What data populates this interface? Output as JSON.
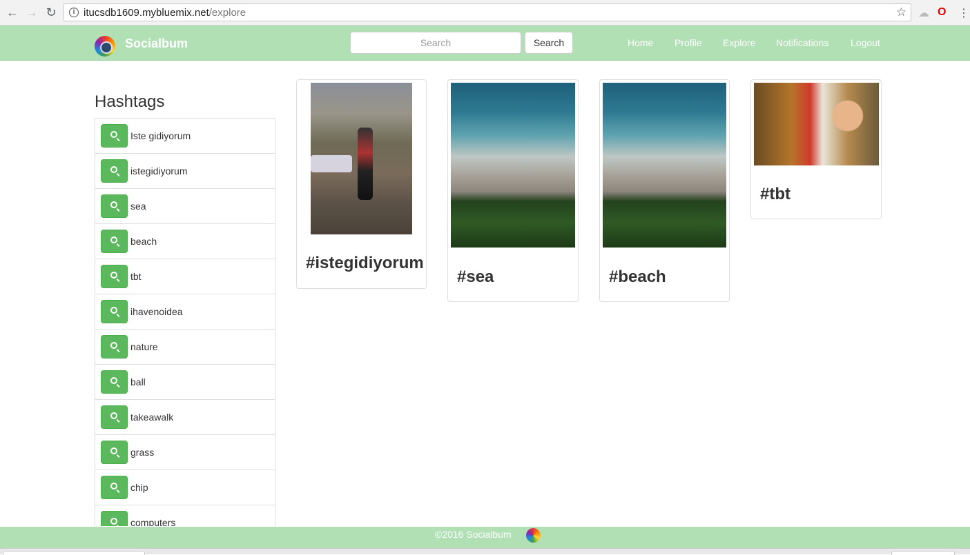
{
  "browser": {
    "url_domain": "itucsdb1609.mybluemix.net",
    "url_path": "/explore"
  },
  "navbar": {
    "brand": "Socialbum",
    "search_placeholder": "Search",
    "search_button": "Search",
    "links": [
      "Home",
      "Profile",
      "Explore",
      "Notifications",
      "Logout"
    ]
  },
  "sidebar": {
    "title": "Hashtags",
    "tags": [
      "Iste gidiyorum",
      "istegidiyorum",
      "sea",
      "beach",
      "tbt",
      "ihavenoidea",
      "nature",
      "ball",
      "takeawalk",
      "grass",
      "chip",
      "computers"
    ]
  },
  "cards": [
    {
      "caption": "#istegidiyorum",
      "image": "unicycle-mountain-photo"
    },
    {
      "caption": "#sea",
      "image": "beach-aerial-photo"
    },
    {
      "caption": "#beach",
      "image": "beach-aerial-photo"
    },
    {
      "caption": "#tbt",
      "image": "girl-writing-photo"
    }
  ],
  "footer": {
    "text": "©2016 Socialbum"
  }
}
